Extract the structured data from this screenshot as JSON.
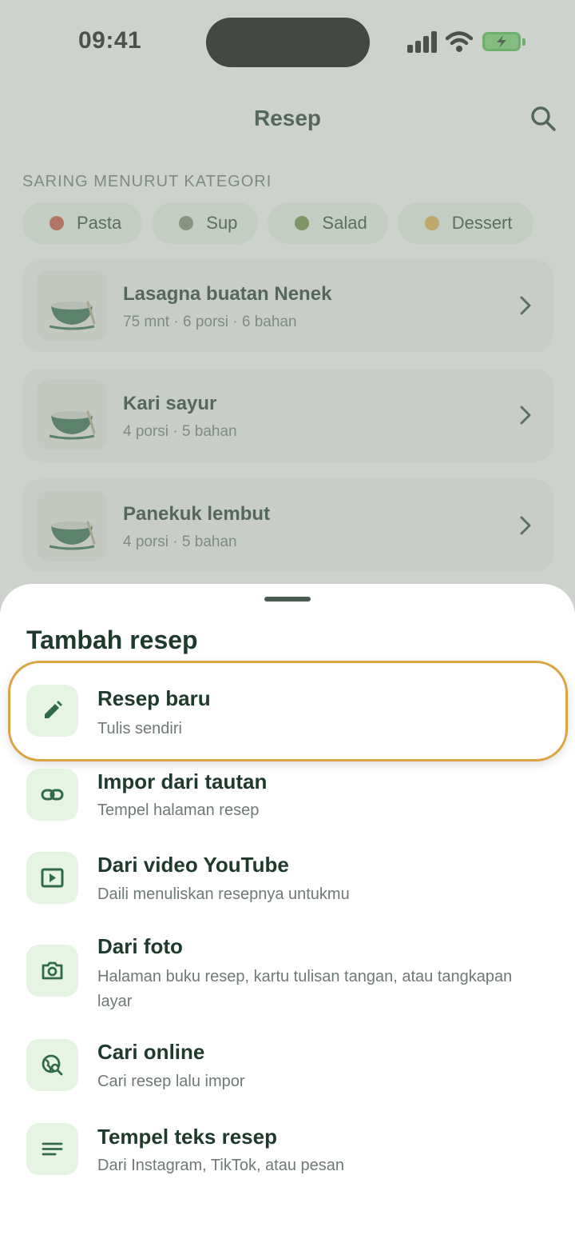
{
  "status_bar": {
    "time": "09:41"
  },
  "header": {
    "title": "Resep",
    "search_icon": "search-icon"
  },
  "filter": {
    "label": "SARING MENURUT KATEGORI",
    "chips": [
      {
        "label": "Pasta",
        "icon": "pasta-icon",
        "color": "#c8553d"
      },
      {
        "label": "Sup",
        "icon": "soup-icon",
        "color": "#7f8a6a"
      },
      {
        "label": "Salad",
        "icon": "salad-icon",
        "color": "#6a8f3a"
      },
      {
        "label": "Dessert",
        "icon": "cake-icon",
        "color": "#e0b04a"
      }
    ]
  },
  "recipes": [
    {
      "title": "Lasagna buatan Nenek",
      "meta": "75 mnt · 6 porsi · 6 bahan"
    },
    {
      "title": "Kari sayur",
      "meta": "4 porsi · 5 bahan"
    },
    {
      "title": "Panekuk lembut",
      "meta": "4 porsi · 5 bahan"
    }
  ],
  "sheet": {
    "title": "Tambah resep",
    "options": [
      {
        "title": "Resep baru",
        "subtitle": "Tulis sendiri",
        "icon": "pencil-icon"
      },
      {
        "title": "Impor dari tautan",
        "subtitle": "Tempel halaman resep",
        "icon": "link-icon"
      },
      {
        "title": "Dari video YouTube",
        "subtitle": "Daili menuliskan resepnya untukmu",
        "icon": "video-play-icon"
      },
      {
        "title": "Dari foto",
        "subtitle": "Halaman buku resep, kartu tulisan tangan, atau tangkapan layar",
        "icon": "camera-icon"
      },
      {
        "title": "Cari online",
        "subtitle": "Cari resep lalu impor",
        "icon": "globe-search-icon"
      },
      {
        "title": "Tempel teks resep",
        "subtitle": "Dari Instagram, TikTok, atau pesan",
        "icon": "text-lines-icon"
      }
    ]
  },
  "colors": {
    "accent": "#2f6b4a",
    "icon_bg": "#e6f4e3",
    "highlight": "#d9a441"
  }
}
